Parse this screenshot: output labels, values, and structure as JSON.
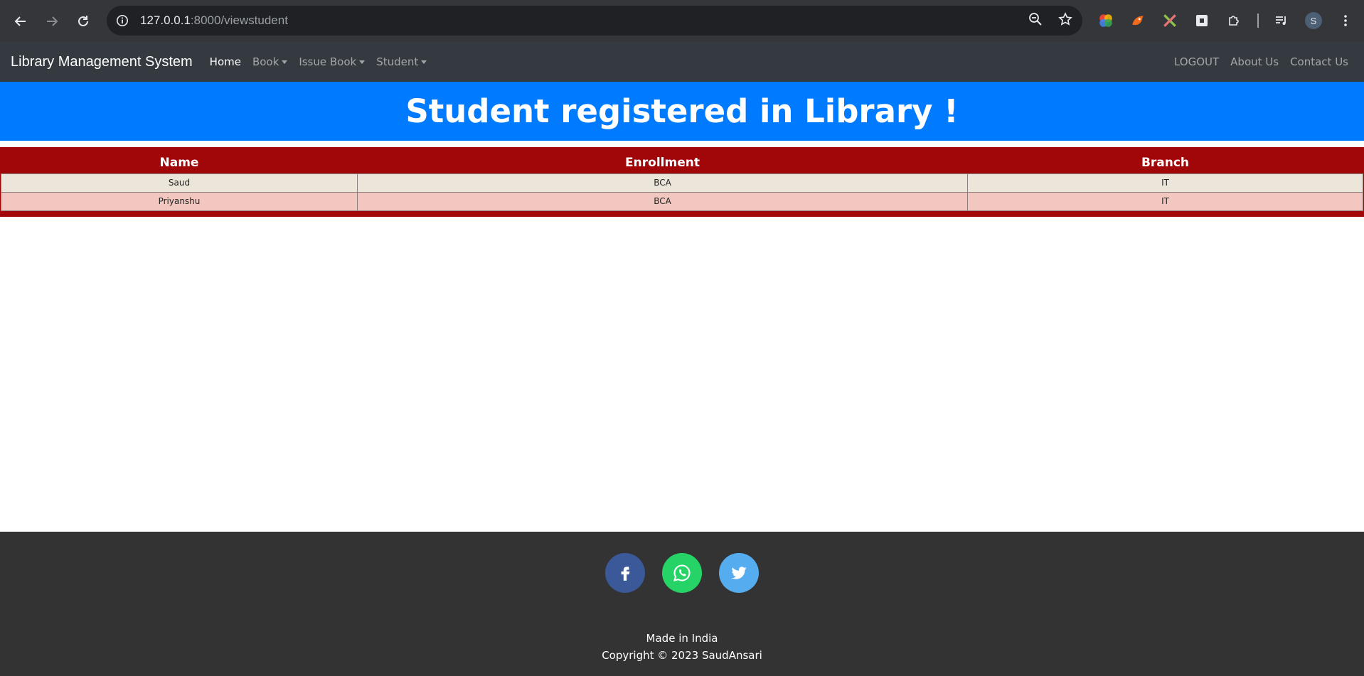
{
  "browser": {
    "url_host": "127.0.0.1",
    "url_rest": ":8000/viewstudent",
    "profile_initial": "S"
  },
  "navbar": {
    "brand": "Library Management System",
    "links": [
      {
        "label": "Home"
      },
      {
        "label": "Book"
      },
      {
        "label": "Issue Book"
      },
      {
        "label": "Student"
      }
    ],
    "right_links": [
      {
        "label": "LOGOUT"
      },
      {
        "label": "About Us"
      },
      {
        "label": "Contact Us"
      }
    ]
  },
  "heading": "Student registered in Library !",
  "table": {
    "headers": [
      "Name",
      "Enrollment",
      "Branch"
    ],
    "rows": [
      [
        "Saud",
        "BCA",
        "IT"
      ],
      [
        "Priyanshu",
        "BCA",
        "IT"
      ]
    ]
  },
  "footer": {
    "social": [
      {
        "icon": "facebook-icon",
        "color": "#3b5998"
      },
      {
        "icon": "whatsapp-icon",
        "color": "#25d366"
      },
      {
        "icon": "twitter-icon",
        "color": "#55acee"
      }
    ],
    "line1": "Made in India",
    "line2": "Copyright © 2023 SaudAnsari"
  },
  "colors": {
    "banner": "#007bff",
    "table_bg": "#a10709",
    "row_odd": "#ece5da",
    "row_even": "#f2c7c0",
    "navbar": "#343a40",
    "footer": "#333333"
  }
}
